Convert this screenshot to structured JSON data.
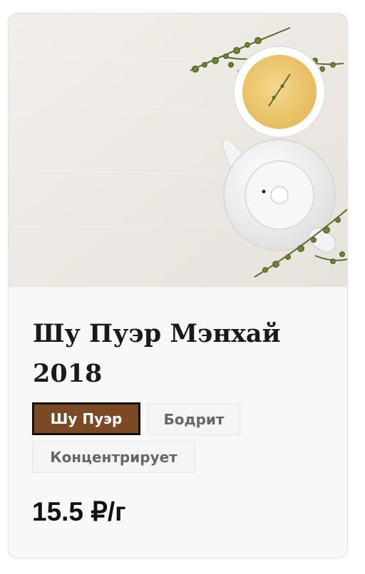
{
  "product": {
    "title": "Шу Пуэр Мэнхай 2018",
    "image_alt": "teapot-and-cup-photo",
    "tags": [
      {
        "label": "Шу Пуэр",
        "active": true
      },
      {
        "label": "Бодрит",
        "active": false
      },
      {
        "label": "Концентрирует",
        "active": false
      }
    ],
    "price": "15.5 ₽/г"
  },
  "colors": {
    "tag_active_bg": "#7b4a24",
    "tag_active_border": "#111111",
    "card_bg": "#f8f8f8"
  }
}
